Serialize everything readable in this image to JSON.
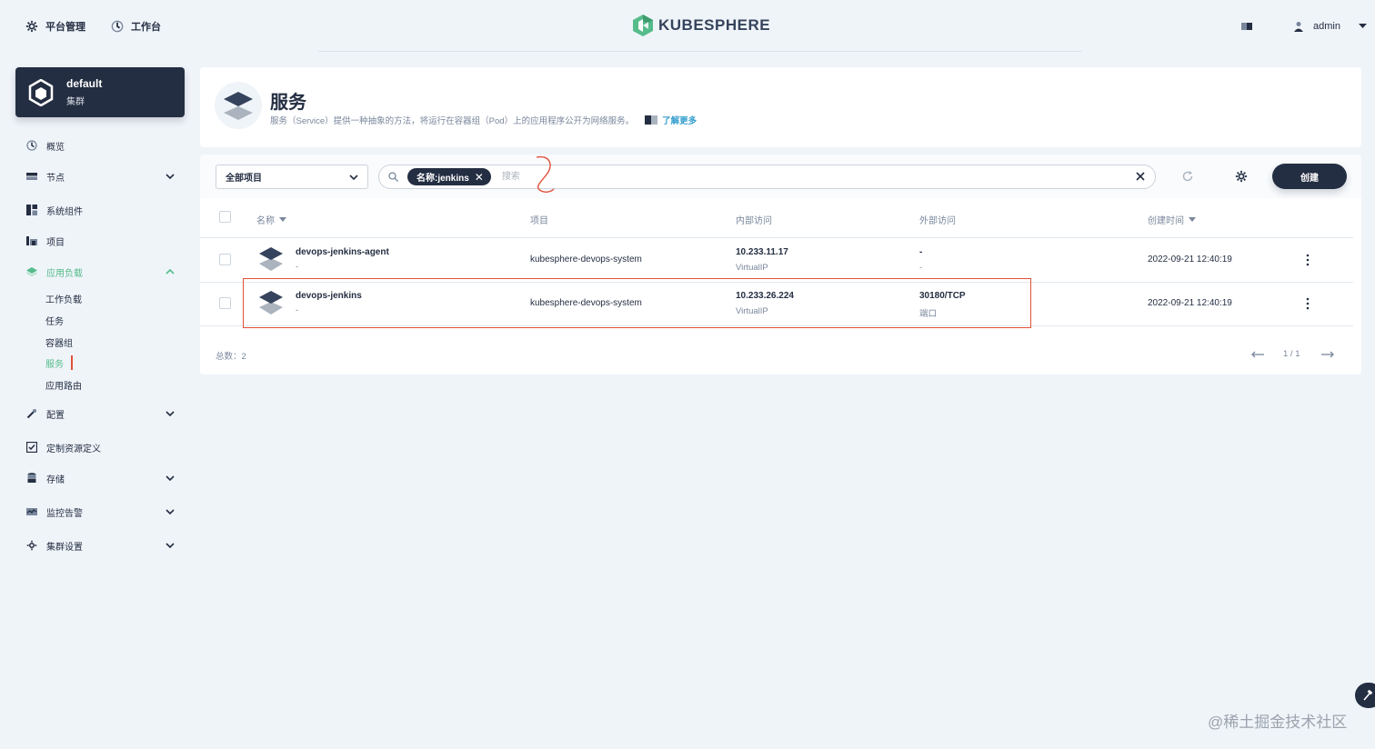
{
  "topbar": {
    "platform_label": "平台管理",
    "workbench_label": "工作台",
    "logo_text": "KUBESPHERE",
    "user_name": "admin"
  },
  "sidebar": {
    "cluster_name": "default",
    "cluster_sub": "集群",
    "items": {
      "overview": "概览",
      "nodes": "节点",
      "components": "系统组件",
      "projects": "项目",
      "workloads": "应用负载",
      "config": "配置",
      "crd": "定制资源定义",
      "storage": "存储",
      "monitoring": "监控告警",
      "settings": "集群设置"
    },
    "workload_children": {
      "workloads": "工作负载",
      "jobs": "任务",
      "pods": "容器组",
      "services": "服务",
      "ingress": "应用路由"
    }
  },
  "header": {
    "title": "服务",
    "description": "服务（Service）提供一种抽象的方法，将运行在容器组（Pod）上的应用程序公开为网络服务。",
    "learn_more": "了解更多"
  },
  "toolbar": {
    "project_select": "全部项目",
    "filter_tag": "名称:jenkins",
    "search_placeholder": "搜索",
    "create_label": "创建"
  },
  "table": {
    "headers": {
      "name": "名称",
      "project": "项目",
      "internal": "内部访问",
      "external": "外部访问",
      "created": "创建时间"
    },
    "rows": [
      {
        "name": "devops-jenkins-agent",
        "desc": "-",
        "project": "kubesphere-devops-system",
        "internal_ip": "10.233.11.17",
        "internal_type": "VirtualIP",
        "external": "-",
        "external_sub": "-",
        "created": "2022-09-21 12:40:19"
      },
      {
        "name": "devops-jenkins",
        "desc": "-",
        "project": "kubesphere-devops-system",
        "internal_ip": "10.233.26.224",
        "internal_type": "VirtualIP",
        "external": "30180/TCP",
        "external_sub": "端口",
        "created": "2022-09-21 12:40:19"
      }
    ]
  },
  "footer": {
    "total": "总数：2",
    "page": "1 / 1"
  },
  "watermark": "@稀土掘金技术社区",
  "colors": {
    "accent": "#55bc8a",
    "dark": "#242e42",
    "link": "#329dce",
    "annotation": "#e0503a"
  }
}
